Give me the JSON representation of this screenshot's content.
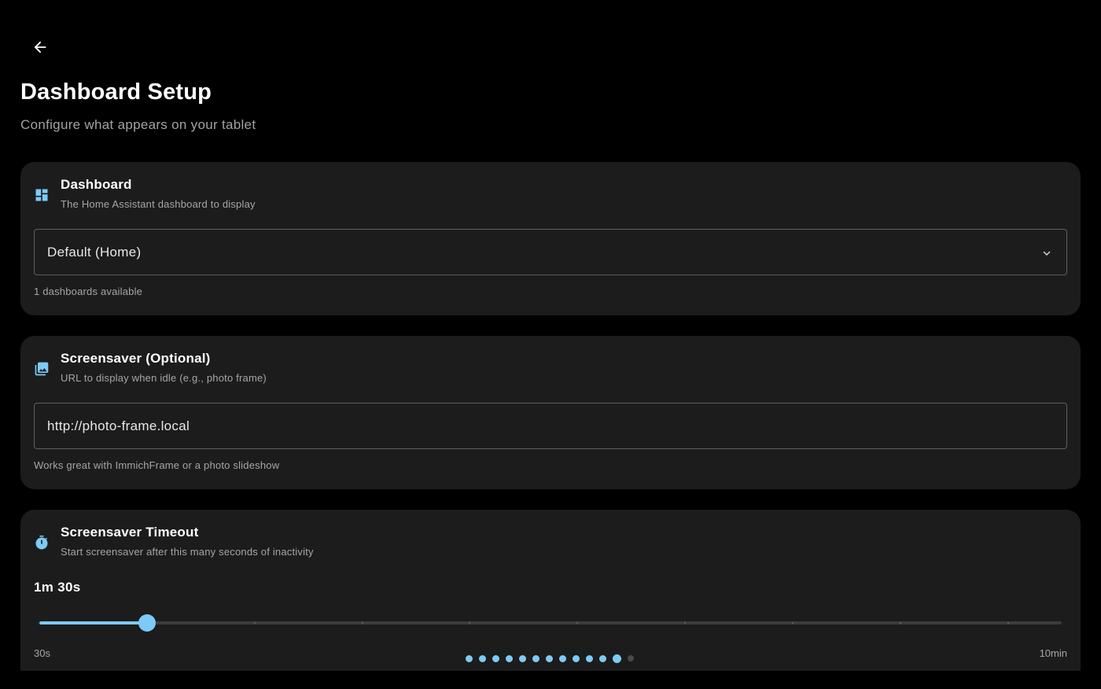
{
  "header": {
    "back_icon": "arrow-left-icon",
    "title": "Dashboard Setup",
    "subtitle": "Configure what appears on your tablet"
  },
  "dashboard_card": {
    "icon": "dashboard-icon",
    "title": "Dashboard",
    "description": "The Home Assistant dashboard to display",
    "selected_value": "Default (Home)",
    "helper": "1 dashboards available"
  },
  "screensaver_card": {
    "icon": "image-gallery-icon",
    "title": "Screensaver (Optional)",
    "description": "URL to display when idle (e.g., photo frame)",
    "url_value": "http://photo-frame.local",
    "helper": "Works great with ImmichFrame or a photo slideshow"
  },
  "timeout_card": {
    "icon": "timer-icon",
    "title": "Screensaver Timeout",
    "description": "Start screensaver after this many seconds of inactivity",
    "value_label": "1m 30s",
    "slider": {
      "min_label": "30s",
      "max_label": "10min",
      "min_seconds": 30,
      "max_seconds": 600,
      "step_seconds": 30,
      "value_seconds": 90
    }
  },
  "pager": {
    "total": 13,
    "current_index": 11
  },
  "colors": {
    "accent": "#7ccbf6",
    "background": "#000000",
    "card": "#1c1c1c"
  }
}
